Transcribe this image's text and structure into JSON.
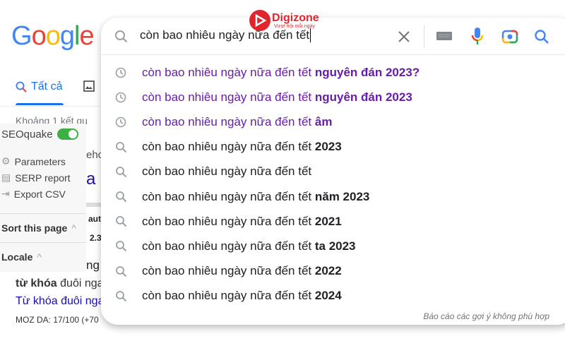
{
  "logo": "Google",
  "tabs": {
    "all": "Tất cả"
  },
  "background": {
    "result_count": "Khoảng 1 kết qu",
    "t1": "ehc",
    "t2": "a c",
    "t3": "aut",
    "t4": "2.3",
    "t5": "ng",
    "t6_bold": "từ khóa",
    "t6_rest": " đuôi nga",
    "t7": "Từ khóa đuôi nga",
    "t8": "MOZ DA: 17/100 (+70"
  },
  "seoquake": {
    "title": "SEOquake",
    "toggle_on": true,
    "items": [
      "Parameters",
      "SERP report",
      "Export CSV"
    ],
    "sort": "Sort this page",
    "locale": "Locale"
  },
  "watermark": {
    "brand": "Digizone",
    "tagline": "Vượt trội mỗi ngày"
  },
  "search": {
    "query": "còn bao nhiêu ngày nữa đến tết"
  },
  "suggestions": [
    {
      "type": "history",
      "prefix": "còn bao nhiêu ngày nữa đến tết ",
      "bold": "nguyên đán 2023?"
    },
    {
      "type": "history",
      "prefix": "còn bao nhiêu ngày nữa đến tết ",
      "bold": "nguyên đán 2023"
    },
    {
      "type": "history",
      "prefix": "còn bao nhiêu ngày nữa đến tết ",
      "bold": "âm"
    },
    {
      "type": "search",
      "prefix": "còn bao nhiêu ngày nữa đến tết ",
      "bold": "2023"
    },
    {
      "type": "search",
      "prefix": "còn bao nhiêu ngày nữa đến tết",
      "bold": ""
    },
    {
      "type": "search",
      "prefix": "còn bao nhiêu ngày nữa đến tết ",
      "bold": "năm 2023"
    },
    {
      "type": "search",
      "prefix": "còn bao nhiêu ngày nữa đến tết ",
      "bold": "2021"
    },
    {
      "type": "search",
      "prefix": "còn bao nhiêu ngày nữa đến tết ",
      "bold": "ta 2023"
    },
    {
      "type": "search",
      "prefix": "còn bao nhiêu ngày nữa đến tết ",
      "bold": "2022"
    },
    {
      "type": "search",
      "prefix": "còn bao nhiêu ngày nữa đến tết ",
      "bold": "2024"
    }
  ],
  "report": "Báo cáo các gợi ý không phù hợp"
}
